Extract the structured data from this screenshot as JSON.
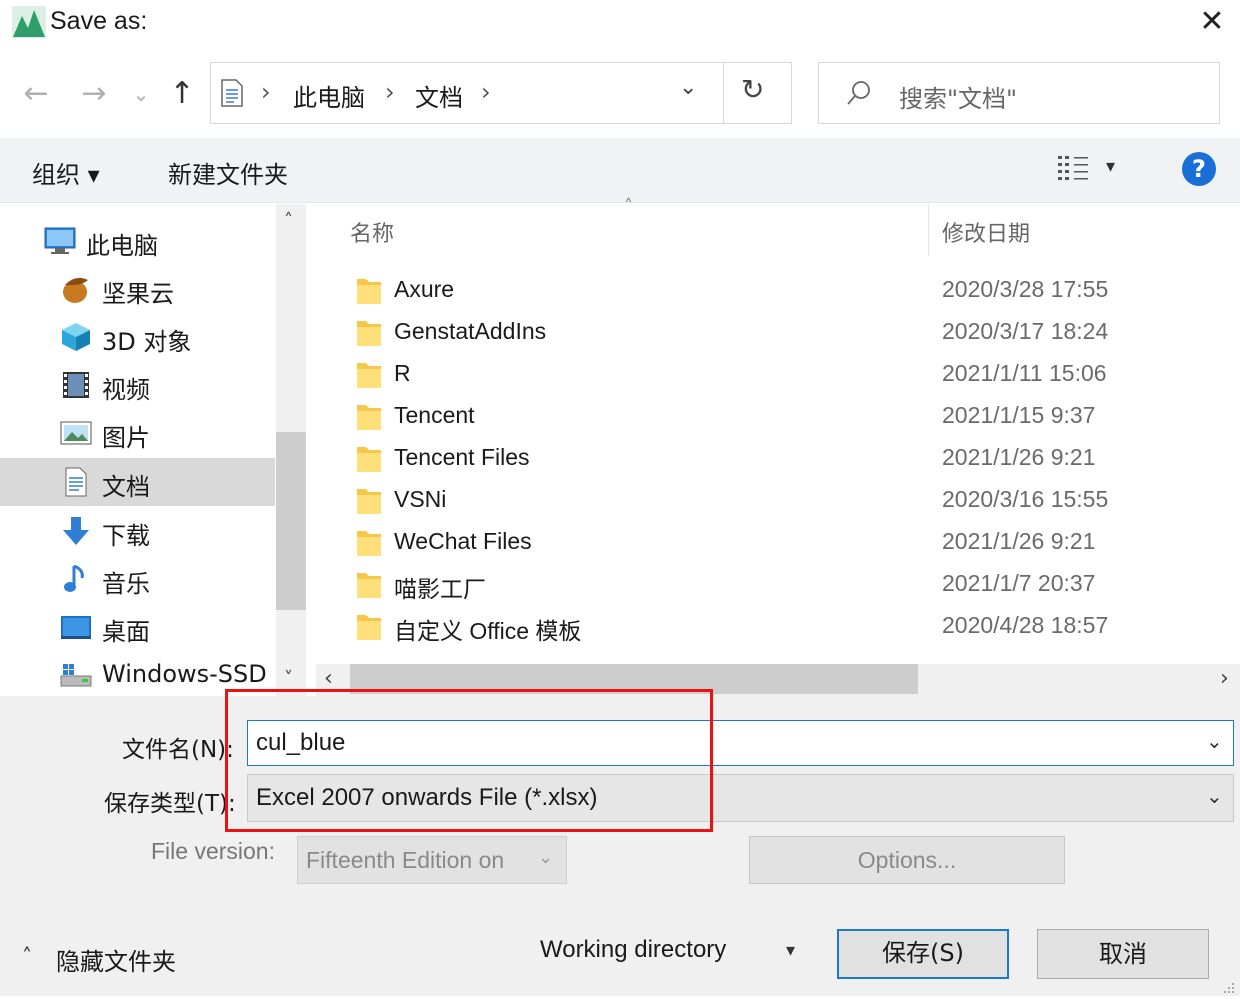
{
  "window": {
    "title": "Save as:",
    "app_icon": "chart-peak-icon",
    "close_glyph": "✕"
  },
  "nav": {
    "back": "←",
    "forward": "→",
    "recent": "⌄",
    "up": "↑"
  },
  "address": {
    "icon": "documents-icon",
    "crumbs": [
      "此电脑",
      "文档"
    ],
    "separator": "›",
    "dropdown": "⌄",
    "refresh": "↻"
  },
  "search": {
    "placeholder": "搜索\"文档\"",
    "icon": "search-icon"
  },
  "toolbar": {
    "organize": "组织 ▾",
    "new_folder": "新建文件夹",
    "view_icon": "list-view-icon",
    "view_dropdown": "▾",
    "help": "?"
  },
  "sidebar": {
    "items": [
      {
        "label": "此电脑",
        "icon": "computer-icon"
      },
      {
        "label": "坚果云",
        "icon": "nut-icon"
      },
      {
        "label": "3D 对象",
        "icon": "cube-icon"
      },
      {
        "label": "视频",
        "icon": "video-icon"
      },
      {
        "label": "图片",
        "icon": "pictures-icon"
      },
      {
        "label": "文档",
        "icon": "documents-icon",
        "selected": true
      },
      {
        "label": "下载",
        "icon": "download-icon"
      },
      {
        "label": "音乐",
        "icon": "music-icon"
      },
      {
        "label": "桌面",
        "icon": "desktop-icon"
      },
      {
        "label": "Windows-SSD",
        "icon": "drive-icon"
      }
    ],
    "scroll_up": "˄",
    "scroll_down": "˅"
  },
  "files": {
    "columns": {
      "name": "名称",
      "date": "修改日期",
      "sort": "˄"
    },
    "rows": [
      {
        "name": "Axure",
        "date": "2020/3/28 17:55"
      },
      {
        "name": "GenstatAddIns",
        "date": "2020/3/17 18:24"
      },
      {
        "name": "R",
        "date": "2021/1/11 15:06"
      },
      {
        "name": "Tencent",
        "date": "2021/1/15 9:37"
      },
      {
        "name": "Tencent Files",
        "date": "2021/1/26 9:21"
      },
      {
        "name": "VSNi",
        "date": "2020/3/16 15:55"
      },
      {
        "name": "WeChat Files",
        "date": "2021/1/26 9:21"
      },
      {
        "name": "喵影工厂",
        "date": "2021/1/7 20:37"
      },
      {
        "name": "自定义 Office 模板",
        "date": "2020/4/28 18:57"
      }
    ],
    "hscroll_left": "‹",
    "hscroll_right": "›"
  },
  "form": {
    "filename_label": "文件名(N):",
    "filename_value": "cul_blue",
    "type_label": "保存类型(T):",
    "type_value": "Excel 2007 onwards File (*.xlsx)",
    "dropdown": "⌄",
    "file_version_label": "File version:",
    "file_version_value": "Fifteenth Edition on",
    "options_label": "Options...",
    "highlight_color": "#ee1111"
  },
  "footer": {
    "hide_folders": "隐藏文件夹",
    "hide_chevron": "˄",
    "working_directory": "Working directory",
    "wd_dropdown": "▾",
    "save": "保存(S)",
    "cancel": "取消"
  },
  "colors": {
    "accent": "#1978d4",
    "help": "#1a6fd6",
    "selected_bg": "#d9d9d9"
  }
}
